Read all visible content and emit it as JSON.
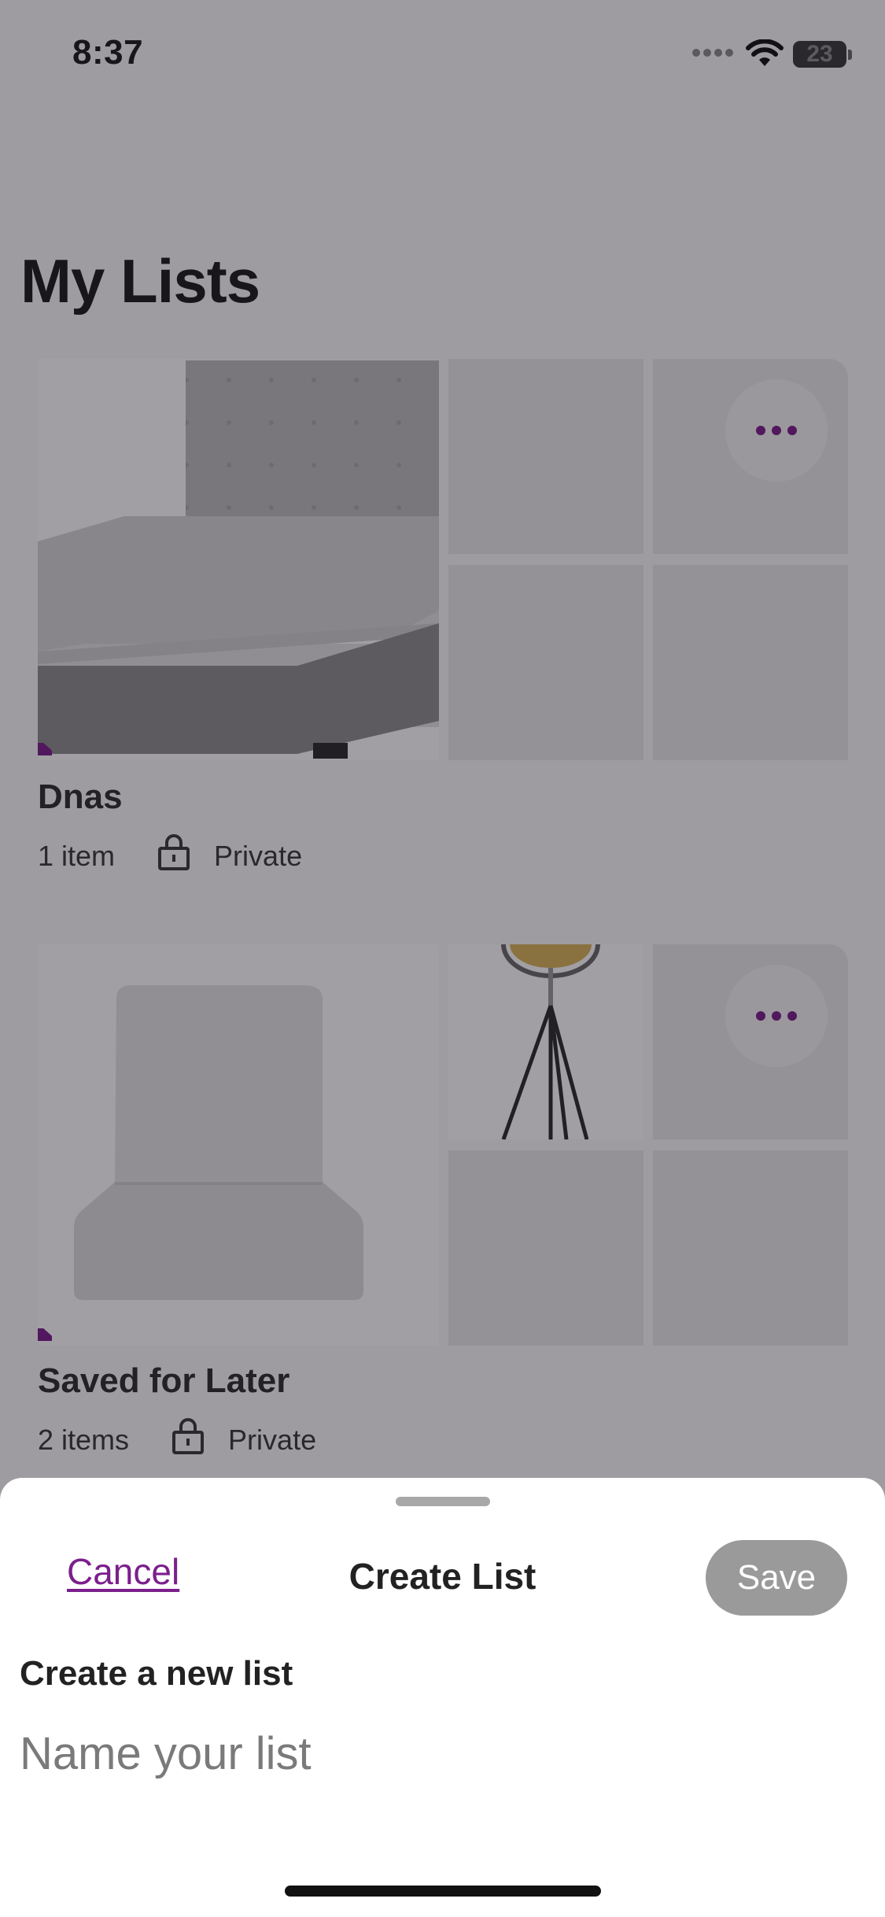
{
  "status_bar": {
    "time": "8:37",
    "battery": "23"
  },
  "page": {
    "title": "My Lists"
  },
  "lists": [
    {
      "name": "Dnas",
      "count": "1 item",
      "privacy": "Private"
    },
    {
      "name": "Saved for Later",
      "count": "2 items",
      "privacy": "Private"
    }
  ],
  "sheet": {
    "cancel_label": "Cancel",
    "title": "Create List",
    "save_label": "Save",
    "section_label": "Create a new list",
    "name_input_placeholder": "Name your list",
    "name_input_value": ""
  },
  "colors": {
    "accent": "#7b1f8c",
    "save_disabled": "#9a9a9a",
    "overlay": "rgba(20,16,26,0.40)"
  },
  "icons": [
    "signal-icon",
    "wifi-icon",
    "battery-icon",
    "more-icon",
    "lock-icon"
  ]
}
